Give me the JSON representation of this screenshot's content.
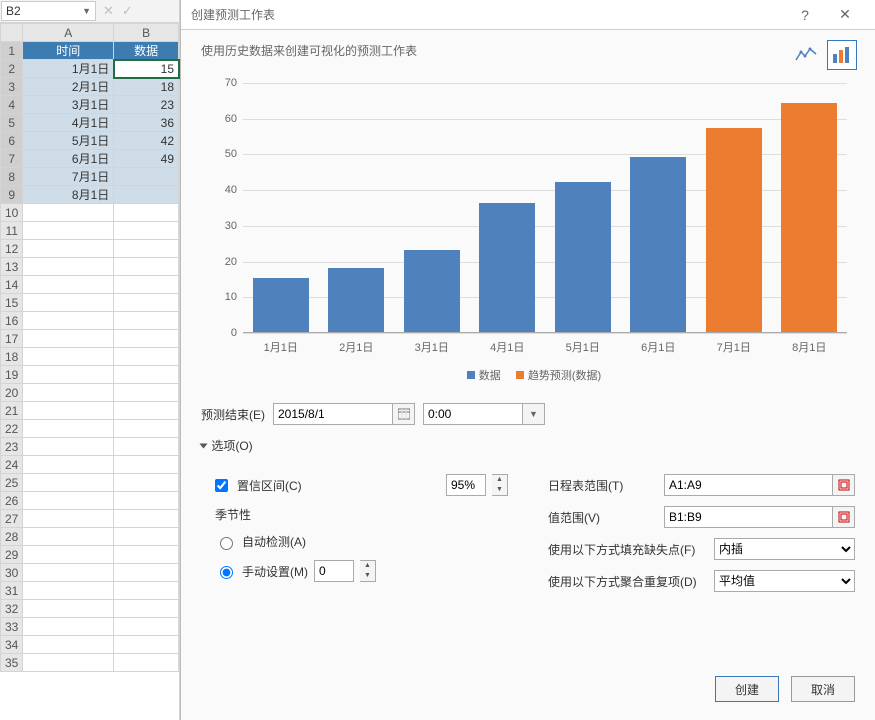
{
  "namebox": {
    "value": "B2"
  },
  "sheet": {
    "columns": [
      "A",
      "B"
    ],
    "headers": {
      "time": "时间",
      "data": "数据"
    },
    "rows": [
      {
        "t": "1月1日",
        "v": "15"
      },
      {
        "t": "2月1日",
        "v": "18"
      },
      {
        "t": "3月1日",
        "v": "23"
      },
      {
        "t": "4月1日",
        "v": "36"
      },
      {
        "t": "5月1日",
        "v": "42"
      },
      {
        "t": "6月1日",
        "v": "49"
      },
      {
        "t": "7月1日",
        "v": ""
      },
      {
        "t": "8月1日",
        "v": ""
      }
    ]
  },
  "dialog": {
    "title": "创建预测工作表",
    "subtitle": "使用历史数据来创建可视化的预测工作表"
  },
  "chart_data": {
    "type": "bar",
    "categories": [
      "1月1日",
      "2月1日",
      "3月1日",
      "4月1日",
      "5月1日",
      "6月1日",
      "7月1日",
      "8月1日"
    ],
    "series": [
      {
        "name": "数据",
        "color": "#4f81bd",
        "values": [
          15,
          18,
          23,
          36,
          42,
          49,
          null,
          null
        ]
      },
      {
        "name": "趋势预测(数据)",
        "color": "#ec7c30",
        "values": [
          null,
          null,
          null,
          null,
          null,
          null,
          57,
          64
        ]
      }
    ],
    "ylabel": "",
    "xlabel": "",
    "yticks": [
      0,
      10,
      20,
      30,
      40,
      50,
      60,
      70
    ],
    "ylim": [
      0,
      70
    ],
    "legend": [
      "数据",
      "趋势预测(数据)"
    ]
  },
  "form": {
    "forecast_end_label": "预测结束(E)",
    "forecast_end_date": "2015/8/1",
    "forecast_end_time": "0:00",
    "options_label": "选项(O)",
    "confidence_label": "置信区间(C)",
    "confidence_value": "95%",
    "seasonality_label": "季节性",
    "auto_detect_label": "自动检测(A)",
    "manual_set_label": "手动设置(M)",
    "manual_value": "0",
    "timeline_range_label": "日程表范围(T)",
    "timeline_range_value": "A1:A9",
    "value_range_label": "值范围(V)",
    "value_range_value": "B1:B9",
    "fill_missing_label": "使用以下方式填充缺失点(F)",
    "fill_missing_value": "内插",
    "aggregate_label": "使用以下方式聚合重复项(D)",
    "aggregate_value": "平均值"
  },
  "buttons": {
    "create": "创建",
    "cancel": "取消"
  }
}
